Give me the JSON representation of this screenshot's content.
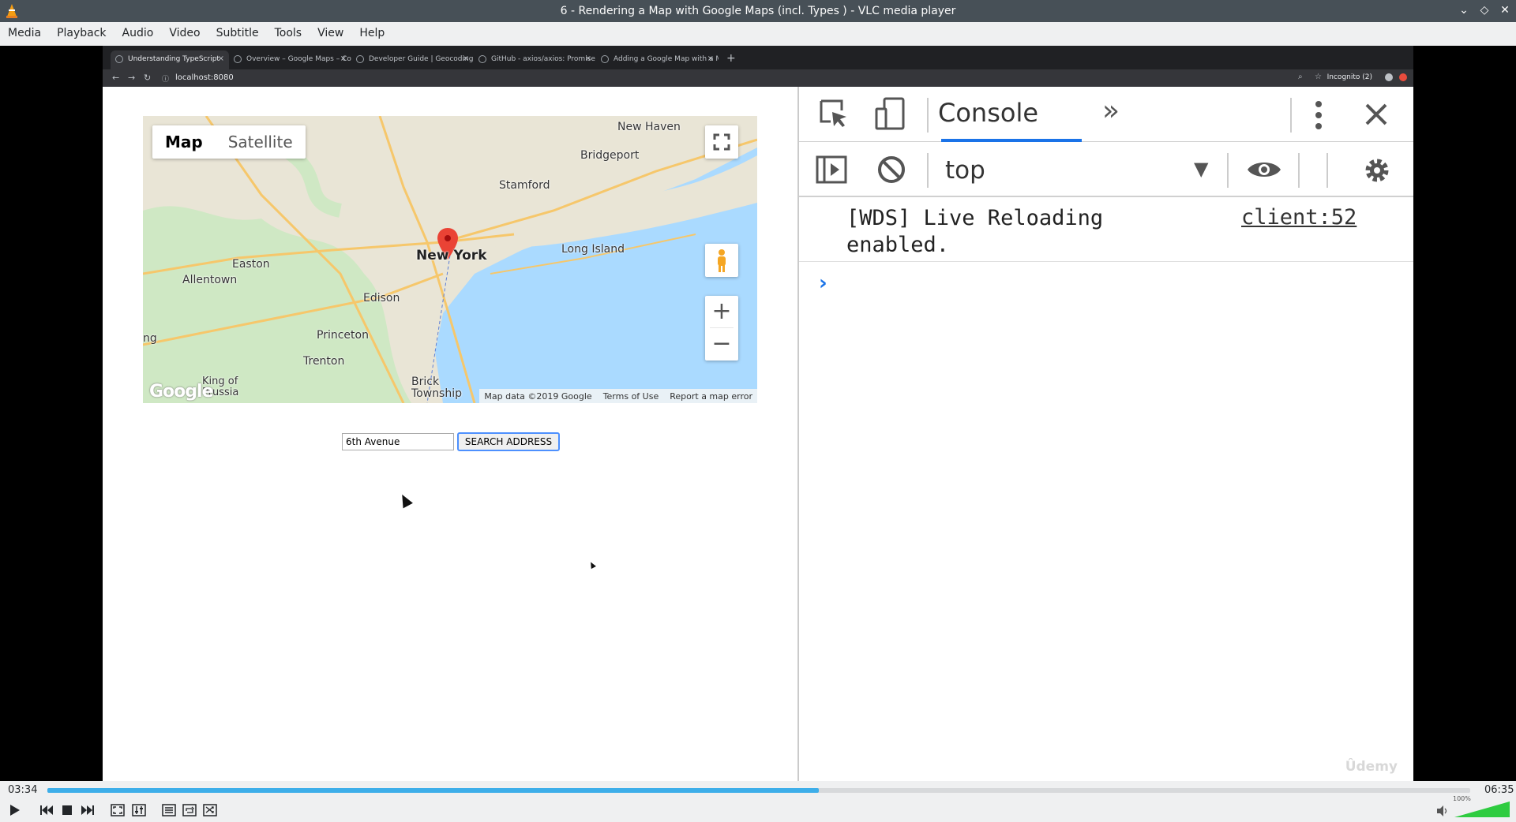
{
  "window": {
    "title": "6 - Rendering a Map with Google Maps (incl. Types ) - VLC media player"
  },
  "menu": [
    "Media",
    "Playback",
    "Audio",
    "Video",
    "Subtitle",
    "Tools",
    "View",
    "Help"
  ],
  "browser": {
    "tabs": [
      {
        "label": "Understanding TypeScript",
        "active": true
      },
      {
        "label": "Overview – Google Maps – Co",
        "active": false
      },
      {
        "label": "Developer Guide | Geocoding",
        "active": false
      },
      {
        "label": "GitHub - axios/axios: Promise",
        "active": false
      },
      {
        "label": "Adding a Google Map with a M",
        "active": false
      }
    ],
    "url": "localhost:8080",
    "incognito": "Incognito (2)"
  },
  "map": {
    "type_map": "Map",
    "type_satellite": "Satellite",
    "places": [
      "New Haven",
      "Bridgeport",
      "Stamford",
      "New York",
      "Long Island",
      "Easton",
      "Allentown",
      "Edison",
      "Princeton",
      "Trenton",
      "King of Prussia",
      "Brick Township",
      "ng"
    ],
    "attribution": [
      "Map data ©2019 Google",
      "Terms of Use",
      "Report a map error"
    ],
    "google_logo": "Google"
  },
  "search": {
    "value": "6th Avenue",
    "button": "SEARCH ADDRESS"
  },
  "devtools": {
    "tab": "Console",
    "context": "top",
    "log_message": "[WDS] Live Reloading enabled.",
    "log_source": "client:52",
    "prompt": "›"
  },
  "watermark": "Ûdemy",
  "player": {
    "elapsed": "03:34",
    "total": "06:35",
    "progress": 0.542,
    "volume": "100%",
    "accent": "#3daee9"
  }
}
